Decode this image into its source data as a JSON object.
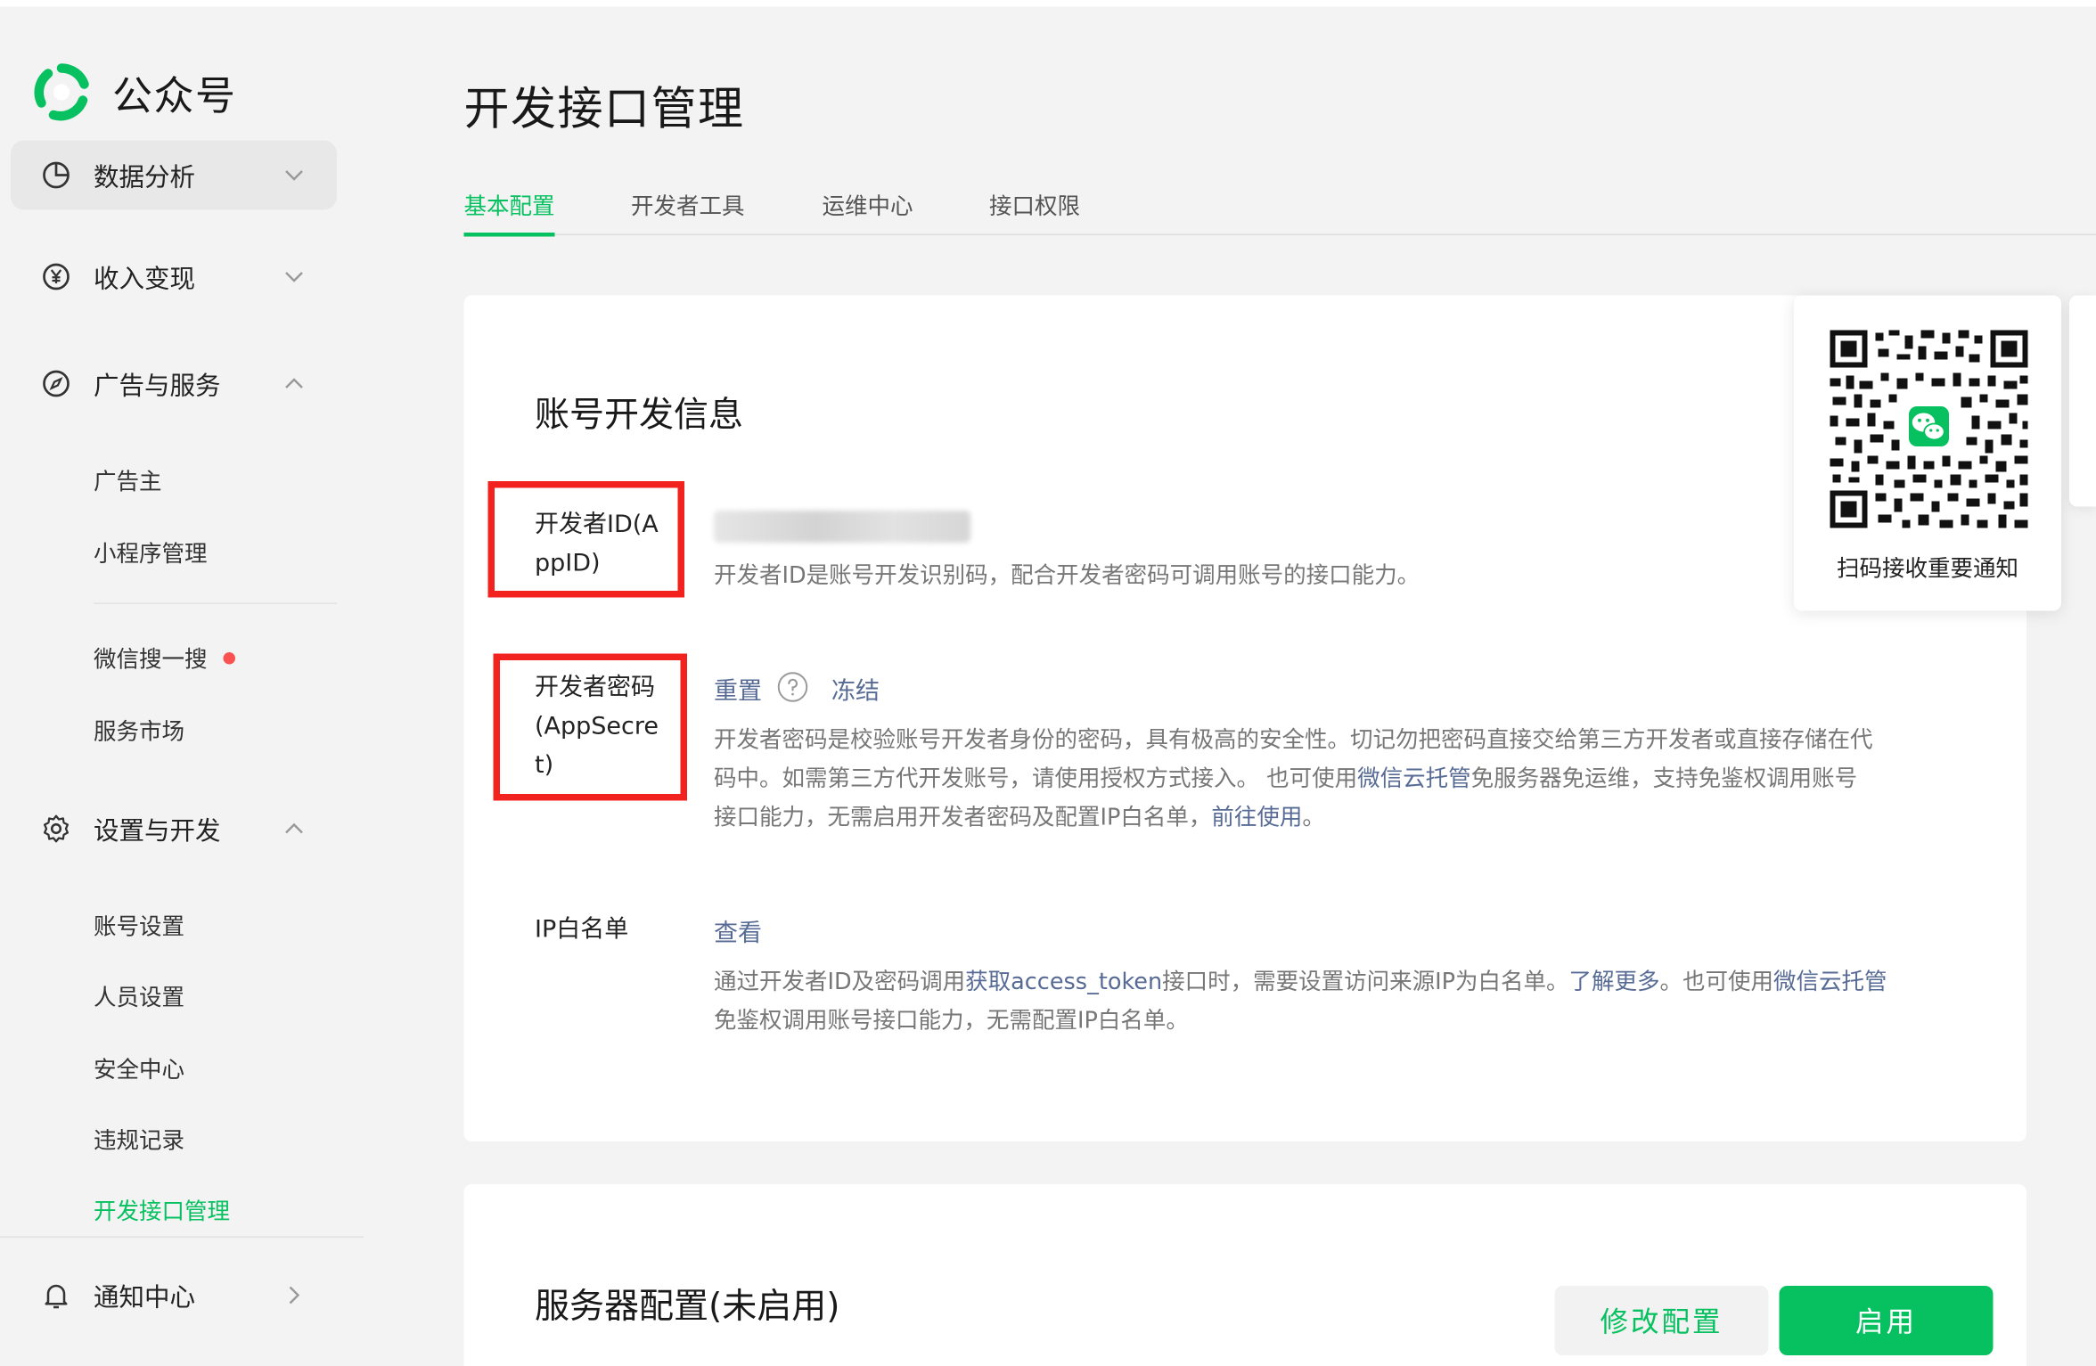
{
  "app": {
    "name": "公众号"
  },
  "sidebar": {
    "groups": [
      {
        "label": "数据分析",
        "icon": "chart-pie-icon",
        "expanded": false
      },
      {
        "label": "收入变现",
        "icon": "yen-circle-icon",
        "expanded": false
      },
      {
        "label": "广告与服务",
        "icon": "compass-icon",
        "expanded": true
      },
      {
        "label": "设置与开发",
        "icon": "gear-icon",
        "expanded": true
      },
      {
        "label": "通知中心",
        "icon": "bell-icon",
        "expanded": false
      }
    ],
    "ads_items": [
      "广告主",
      "小程序管理",
      "微信搜一搜",
      "服务市场"
    ],
    "settings_items": [
      "账号设置",
      "人员设置",
      "安全中心",
      "违规记录",
      "开发接口管理"
    ],
    "current_item": "开发接口管理"
  },
  "page": {
    "title": "开发接口管理",
    "tabs": [
      "基本配置",
      "开发者工具",
      "运维中心",
      "接口权限"
    ],
    "active_tab": "基本配置"
  },
  "account_dev": {
    "title": "账号开发信息",
    "appid": {
      "label_line1": "开发者ID(A",
      "label_line2": "ppID)",
      "desc": "开发者ID是账号开发识别码，配合开发者密码可调用账号的接口能力。"
    },
    "secret": {
      "label_line1": "开发者密码",
      "label_line2": "(AppSecre",
      "label_line3": "t)",
      "reset": "重置",
      "freeze": "冻结",
      "desc_line1": "开发者密码是校验账号开发者身份的密码，具有极高的安全性。切记勿把密码直接交给第三方开发者或直接存储在代",
      "desc_line2_a": "码中。如需第三方代开发账号，请使用授权方式接入。 也可使用",
      "desc_line2_link": "微信云托管",
      "desc_line2_b": "免服务器免运维，支持免鉴权调用账号",
      "desc_line3_a": "接口能力，无需启用开发者密码及配置IP白名单，",
      "desc_line3_link": "前往使用",
      "desc_line3_b": "。"
    },
    "ip_whitelist": {
      "label": "IP白名单",
      "view": "查看",
      "desc_line1_a": "通过开发者ID及密码调用",
      "desc_line1_link1": "获取access_token",
      "desc_line1_b": "接口时，需要设置访问来源IP为白名单。",
      "desc_line1_link2": "了解更多",
      "desc_line1_c": "。也可使用",
      "desc_line1_link3": "微信云托管",
      "desc_line2": "免鉴权调用账号接口能力，无需配置IP白名单。"
    }
  },
  "qr": {
    "label": "扫码接收重要通知"
  },
  "server_config": {
    "title": "服务器配置(未启用)",
    "modify_button": "修改配置",
    "enable_button": "启用"
  },
  "colors": {
    "accent": "#07c160",
    "link": "#576b95",
    "highlight_box": "#f2231f",
    "notice_dot": "#fa5151"
  }
}
